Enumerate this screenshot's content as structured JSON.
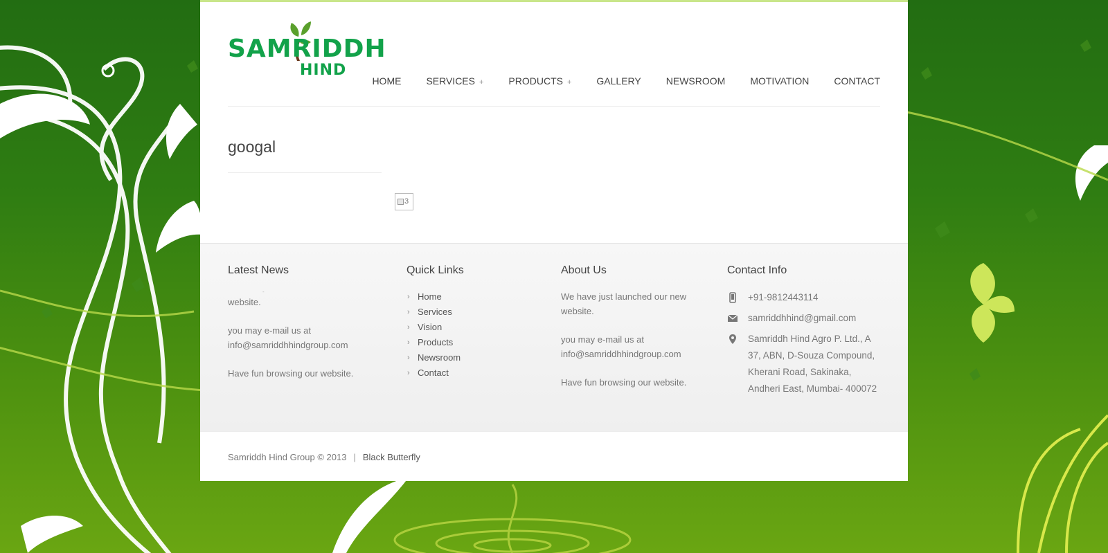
{
  "logo": {
    "line1": "SAMRIDDH",
    "line2": "HIND"
  },
  "nav": [
    {
      "label": "HOME",
      "has_submenu": false
    },
    {
      "label": "SERVICES",
      "has_submenu": true
    },
    {
      "label": "PRODUCTS",
      "has_submenu": true
    },
    {
      "label": "GALLERY",
      "has_submenu": false
    },
    {
      "label": "NEWSROOM",
      "has_submenu": false
    },
    {
      "label": "MOTIVATION",
      "has_submenu": false
    },
    {
      "label": "CONTACT",
      "has_submenu": false
    }
  ],
  "nav_submenu_marker": "+",
  "page": {
    "title": "googal",
    "broken_image_alt": "3"
  },
  "footer": {
    "latest_news": {
      "heading": "Latest News",
      "faded_fragment": "-",
      "lines": [
        "website.",
        "you may e-mail us at info@samriddhhindgroup.com",
        "Have fun browsing our website."
      ]
    },
    "quick_links": {
      "heading": "Quick Links",
      "items": [
        "Home",
        "Services",
        "Vision",
        "Products",
        "Newsroom",
        "Contact"
      ]
    },
    "about_us": {
      "heading": "About Us",
      "paragraphs": [
        "We have just launched our new website.",
        "you may e-mail us at info@samriddhhindgroup.com",
        "Have fun browsing our website."
      ]
    },
    "contact_info": {
      "heading": "Contact Info",
      "phone": "+91-9812443114",
      "email": "samriddhhind@gmail.com",
      "address": "Samriddh Hind Agro P. Ltd., A 37, ABN, D-Souza Compound, Kherani Road, Sakinaka, Andheri East, Mumbai- 400072"
    }
  },
  "bottom_bar": {
    "copyright": "Samriddh Hind Group © 2013",
    "separator": "|",
    "credit": "Black Butterfly"
  },
  "colors": {
    "brand_green": "#12a24a",
    "leaf_green": "#5aa02c",
    "trunk_brown": "#6b3a1e",
    "top_accent": "#c9e68a"
  },
  "icons": {
    "phone": "mobile-phone-icon",
    "email": "envelope-icon",
    "address": "map-pin-icon",
    "link_bullet": "chevron-right-icon"
  }
}
